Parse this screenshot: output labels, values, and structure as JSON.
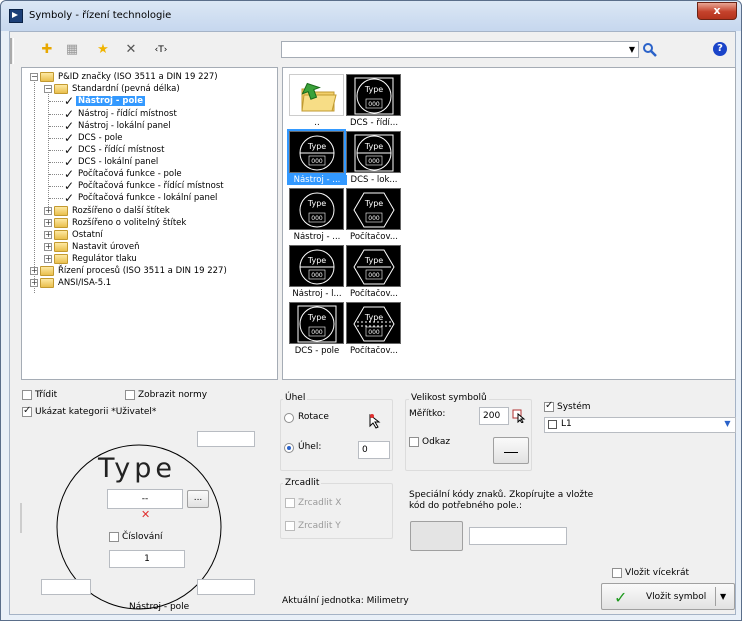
{
  "window": {
    "title": "Symboly - řízení technologie",
    "close": "x"
  },
  "toolbar": {
    "icons": [
      "add-symbol-icon",
      "grid-icon",
      "favorite-star-icon",
      "delete-icon",
      "text-icon"
    ],
    "text_icon": "‹T›",
    "help": "?"
  },
  "tree": {
    "root": "P&ID značky (ISO 3511 a DIN 19 227)",
    "standard": "Standardní (pevná délka)",
    "items": [
      "Nástroj - pole",
      "Nástroj - řídící místnost",
      "Nástroj - lokální panel",
      "DCS - pole",
      "DCS - řídící místnost",
      "DCS - lokální panel",
      "Počítačová funkce - pole",
      "Počítačová funkce - řídící místnost",
      "Počítačová funkce - lokální panel"
    ],
    "groups": [
      "Rozšířeno o další štítek",
      "Rozšířeno o volitelný štítek",
      "Ostatní",
      "Nastavit úroveň",
      "Regulátor tlaku"
    ],
    "roots": [
      "Řízení procesů (ISO 3511 a DIN 19 227)",
      "ANSI/ISA-5.1"
    ]
  },
  "symbols": [
    {
      "label": "..",
      "kind": "folder"
    },
    {
      "label": "DCS - řídí...",
      "kind": "dcs",
      "text": "Type",
      "num": "000"
    },
    {
      "label": "Nástroj - ...",
      "kind": "circle-line",
      "text": "Type",
      "num": "000",
      "selected": true
    },
    {
      "label": "DCS - lok...",
      "kind": "dcs-line",
      "text": "Type",
      "num": "000"
    },
    {
      "label": "Nástroj - ...",
      "kind": "circle",
      "text": "Type",
      "num": "000"
    },
    {
      "label": "Počítačov...",
      "kind": "hex",
      "text": "Type",
      "num": "000"
    },
    {
      "label": "Nástroj - l...",
      "kind": "circle-line",
      "text": "Type",
      "num": "000"
    },
    {
      "label": "Počítačov...",
      "kind": "hex-line",
      "text": "Type",
      "num": "000"
    },
    {
      "label": "DCS - pole",
      "kind": "dcs",
      "text": "Type",
      "num": "000"
    },
    {
      "label": "Počítačov...",
      "kind": "hex-line2",
      "text": "Type",
      "num": "000"
    }
  ],
  "options": {
    "sort": "Třídit",
    "show_norms": "Zobrazit normy",
    "show_category": "Ukázat kategorii *Uživatel*"
  },
  "preview": {
    "type_text": "Type",
    "field_value": "--",
    "browse": "...",
    "numbering": "Číslování",
    "numbering_value": "1",
    "caption": "Nástroj - pole"
  },
  "angle": {
    "title": "Úhel",
    "rotation": "Rotace",
    "angle_label": "Úhel:",
    "angle_value": "0"
  },
  "mirror": {
    "title": "Zrcadlit",
    "x": "Zrcadlit X",
    "y": "Zrcadlit Y"
  },
  "size": {
    "title": "Velikost symbolů",
    "scale_label": "Měřítko:",
    "scale_value": "200",
    "reference": "Odkaz"
  },
  "system": {
    "label": "Systém",
    "value": "L1"
  },
  "special": {
    "text": "Speciální kódy znaků. Zkopírujte a vložte kód do potřebného pole.:"
  },
  "unit": "Aktuální jednotka: Milimetry",
  "insert": {
    "multiple": "Vložit vícekrát",
    "button": "Vložit symbol"
  },
  "colors": {
    "selection": "#3399ff",
    "title_bg": "#c6d7ee",
    "close": "#c4412b"
  }
}
